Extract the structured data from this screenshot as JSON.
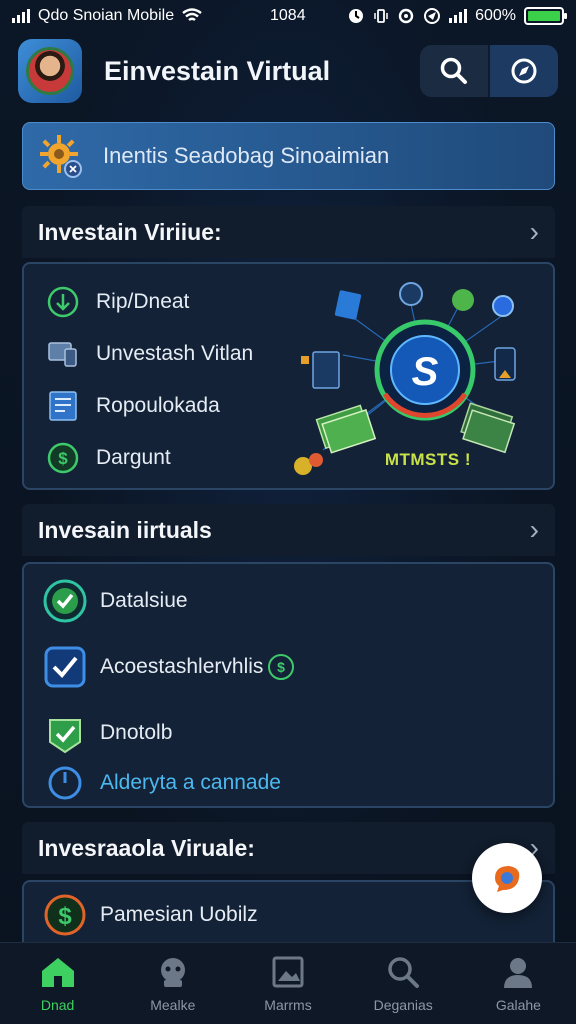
{
  "status_bar": {
    "carrier": "Qdo Snoian Mobile",
    "time": "1084",
    "battery_percent": "600%"
  },
  "header": {
    "title": "Einvestain Virtual"
  },
  "banner": {
    "text": "Inentis Seadobag Sinoaimian"
  },
  "section1": {
    "title": "Investain Viriiue:",
    "items": [
      {
        "label": "Rip/Dneat",
        "icon": "download-circle-icon"
      },
      {
        "label": "Unvestash Vitlan",
        "icon": "device-icon"
      },
      {
        "label": "Ropoulokada",
        "icon": "document-icon"
      },
      {
        "label": "Dargunt",
        "icon": "dollar-circle-icon"
      }
    ],
    "hero_label": "MTMSTS !"
  },
  "section2": {
    "title": "Invesain iirtuals",
    "items": [
      {
        "label": "Datalsiue",
        "icon": "check-circle-icon"
      },
      {
        "label": "Acoestashlervhlis",
        "icon": "checkbox-icon"
      },
      {
        "label": "Dnotolb",
        "icon": "badge-check-icon"
      },
      {
        "label": "Alderyta a cannade",
        "icon": "power-icon"
      }
    ]
  },
  "section3": {
    "title": "Invesraaola Viruale:",
    "items": [
      {
        "label": "Pamesian Uobilz",
        "icon": "dollar-circle-icon"
      }
    ]
  },
  "bottom_nav": [
    {
      "label": "Dnad",
      "icon": "home-icon",
      "active": true
    },
    {
      "label": "Mealke",
      "icon": "robot-icon",
      "active": false
    },
    {
      "label": "Marrms",
      "icon": "image-icon",
      "active": false
    },
    {
      "label": "Deganias",
      "icon": "search-icon",
      "active": false
    },
    {
      "label": "Galahe",
      "icon": "user-icon",
      "active": false
    }
  ],
  "colors": {
    "accent": "#3ed060",
    "banner": "#2f6aa8",
    "background": "#0b1422"
  }
}
